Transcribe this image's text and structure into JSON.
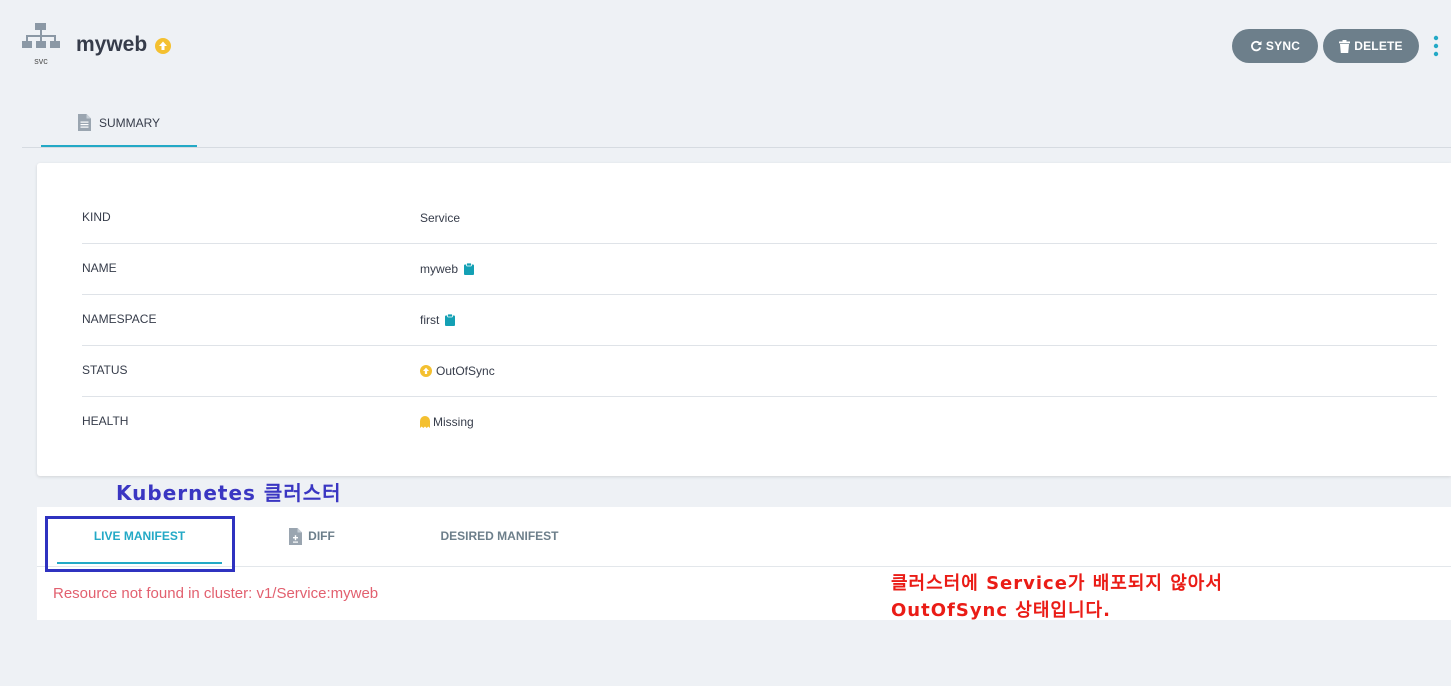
{
  "header": {
    "resource_icon": "network-tree-icon",
    "resource_kind_short": "svc",
    "title": "myweb",
    "title_status_icon": "arrow-circle-up-icon",
    "actions": {
      "sync_label": "SYNC",
      "sync_icon": "refresh-icon",
      "delete_label": "DELETE",
      "delete_icon": "trash-icon",
      "more_icon": "kebab-menu-icon"
    }
  },
  "tabs": [
    {
      "label": "SUMMARY",
      "icon": "file-text-icon",
      "active": true
    }
  ],
  "summary": {
    "rows": [
      {
        "key": "KIND",
        "value": "Service"
      },
      {
        "key": "NAME",
        "value": "myweb",
        "icon": "clipboard-icon"
      },
      {
        "key": "NAMESPACE",
        "value": "first",
        "icon": "clipboard-icon"
      },
      {
        "key": "STATUS",
        "value": "OutOfSync",
        "icon": "arrow-circle-up-icon"
      },
      {
        "key": "HEALTH",
        "value": "Missing",
        "icon": "ghost-icon"
      }
    ]
  },
  "annotations": {
    "top_label": "Kubernetes 클러스터",
    "note_line1": "클러스터에 Service가 배포되지 않아서",
    "note_line2": "OutOfSync 상태입니다."
  },
  "manifest": {
    "tabs": [
      {
        "label": "LIVE MANIFEST",
        "active": true
      },
      {
        "label": "DIFF",
        "icon": "file-diff-icon"
      },
      {
        "label": "DESIRED MANIFEST"
      }
    ],
    "error_text": "Resource not found in cluster: v1/Service:myweb"
  },
  "colors": {
    "accent": "#23a9c6",
    "out_of_sync": "#f4c030",
    "error": "#e2606f",
    "annotation_blue": "#3a36c2",
    "annotation_red": "#ea1c16",
    "button": "#6d7f8b"
  }
}
